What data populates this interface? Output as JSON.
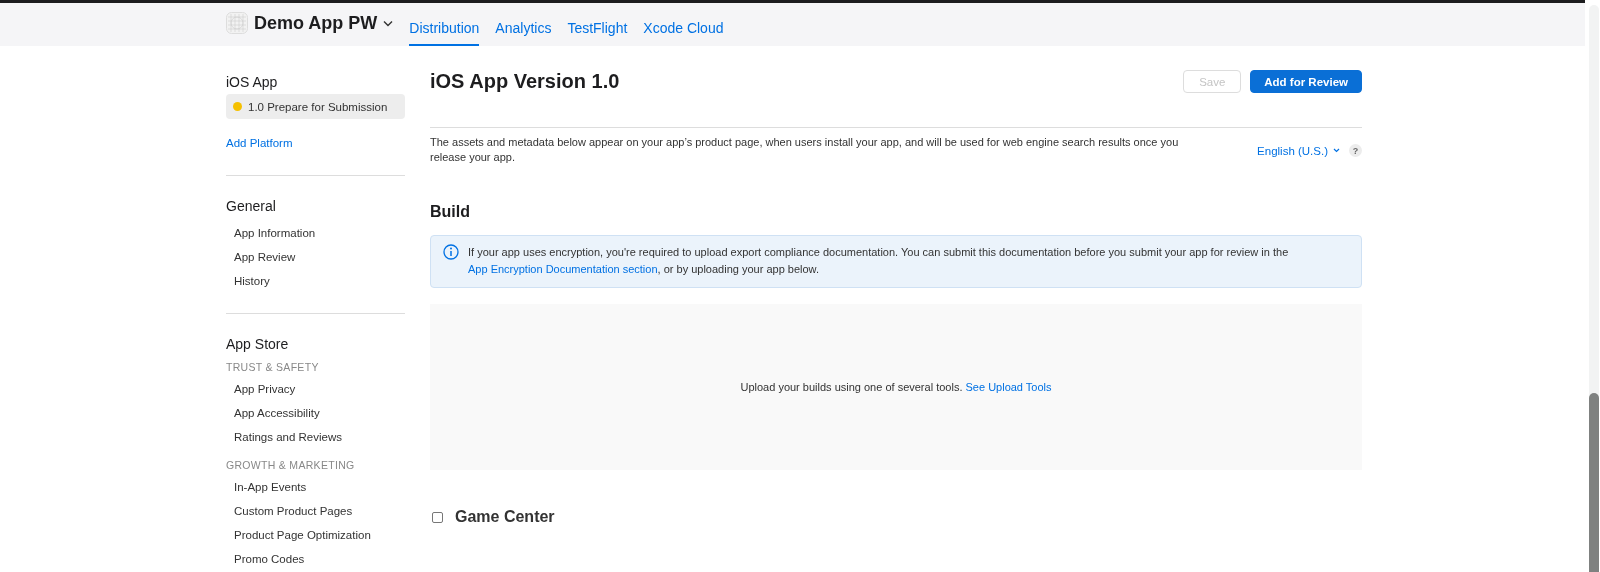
{
  "header": {
    "app_name": "Demo App PW",
    "tabs": [
      {
        "label": "Distribution",
        "selected": true
      },
      {
        "label": "Analytics",
        "selected": false
      },
      {
        "label": "TestFlight",
        "selected": false
      },
      {
        "label": "Xcode Cloud",
        "selected": false
      }
    ]
  },
  "sidebar": {
    "platform": "iOS App",
    "versions": [
      {
        "label": "1.0 Prepare for Submission",
        "selected": true,
        "color": "#f5c000"
      }
    ],
    "add_platform": "Add Platform",
    "sections": [
      {
        "title": "General",
        "groups": [
          {
            "items": [
              "App Information",
              "App Review",
              "History"
            ]
          }
        ]
      },
      {
        "title": "App Store",
        "groups": [
          {
            "heading": "TRUST & SAFETY",
            "items": [
              "App Privacy",
              "App Accessibility",
              "Ratings and Reviews"
            ]
          },
          {
            "heading": "GROWTH & MARKETING",
            "items": [
              "In-App Events",
              "Custom Product Pages",
              "Product Page Optimization",
              "Promo Codes"
            ]
          }
        ]
      }
    ]
  },
  "main": {
    "title": "iOS App Version 1.0",
    "buttons": [
      {
        "label": "Save",
        "kind": "secondary",
        "disabled": true
      },
      {
        "label": "Add for Review",
        "kind": "primary",
        "disabled": false
      }
    ],
    "description": "The assets and metadata below appear on your app’s product page, when users install your app, and will be used for web engine search results once you release your app.",
    "language": "English (U.S.)",
    "help": "?",
    "build": {
      "title": "Build",
      "notice": {
        "text": "If your app uses encryption, you're required to upload export compliance documentation. You can submit this documentation before you submit your app for review in the",
        "link": "App Encryption Documentation section",
        "after": ", or by uploading your app below."
      },
      "upload_text": "Upload your builds using one of several tools.",
      "upload_link": "See Upload Tools"
    },
    "game_center": {
      "title": "Game Center",
      "checked": false
    }
  }
}
